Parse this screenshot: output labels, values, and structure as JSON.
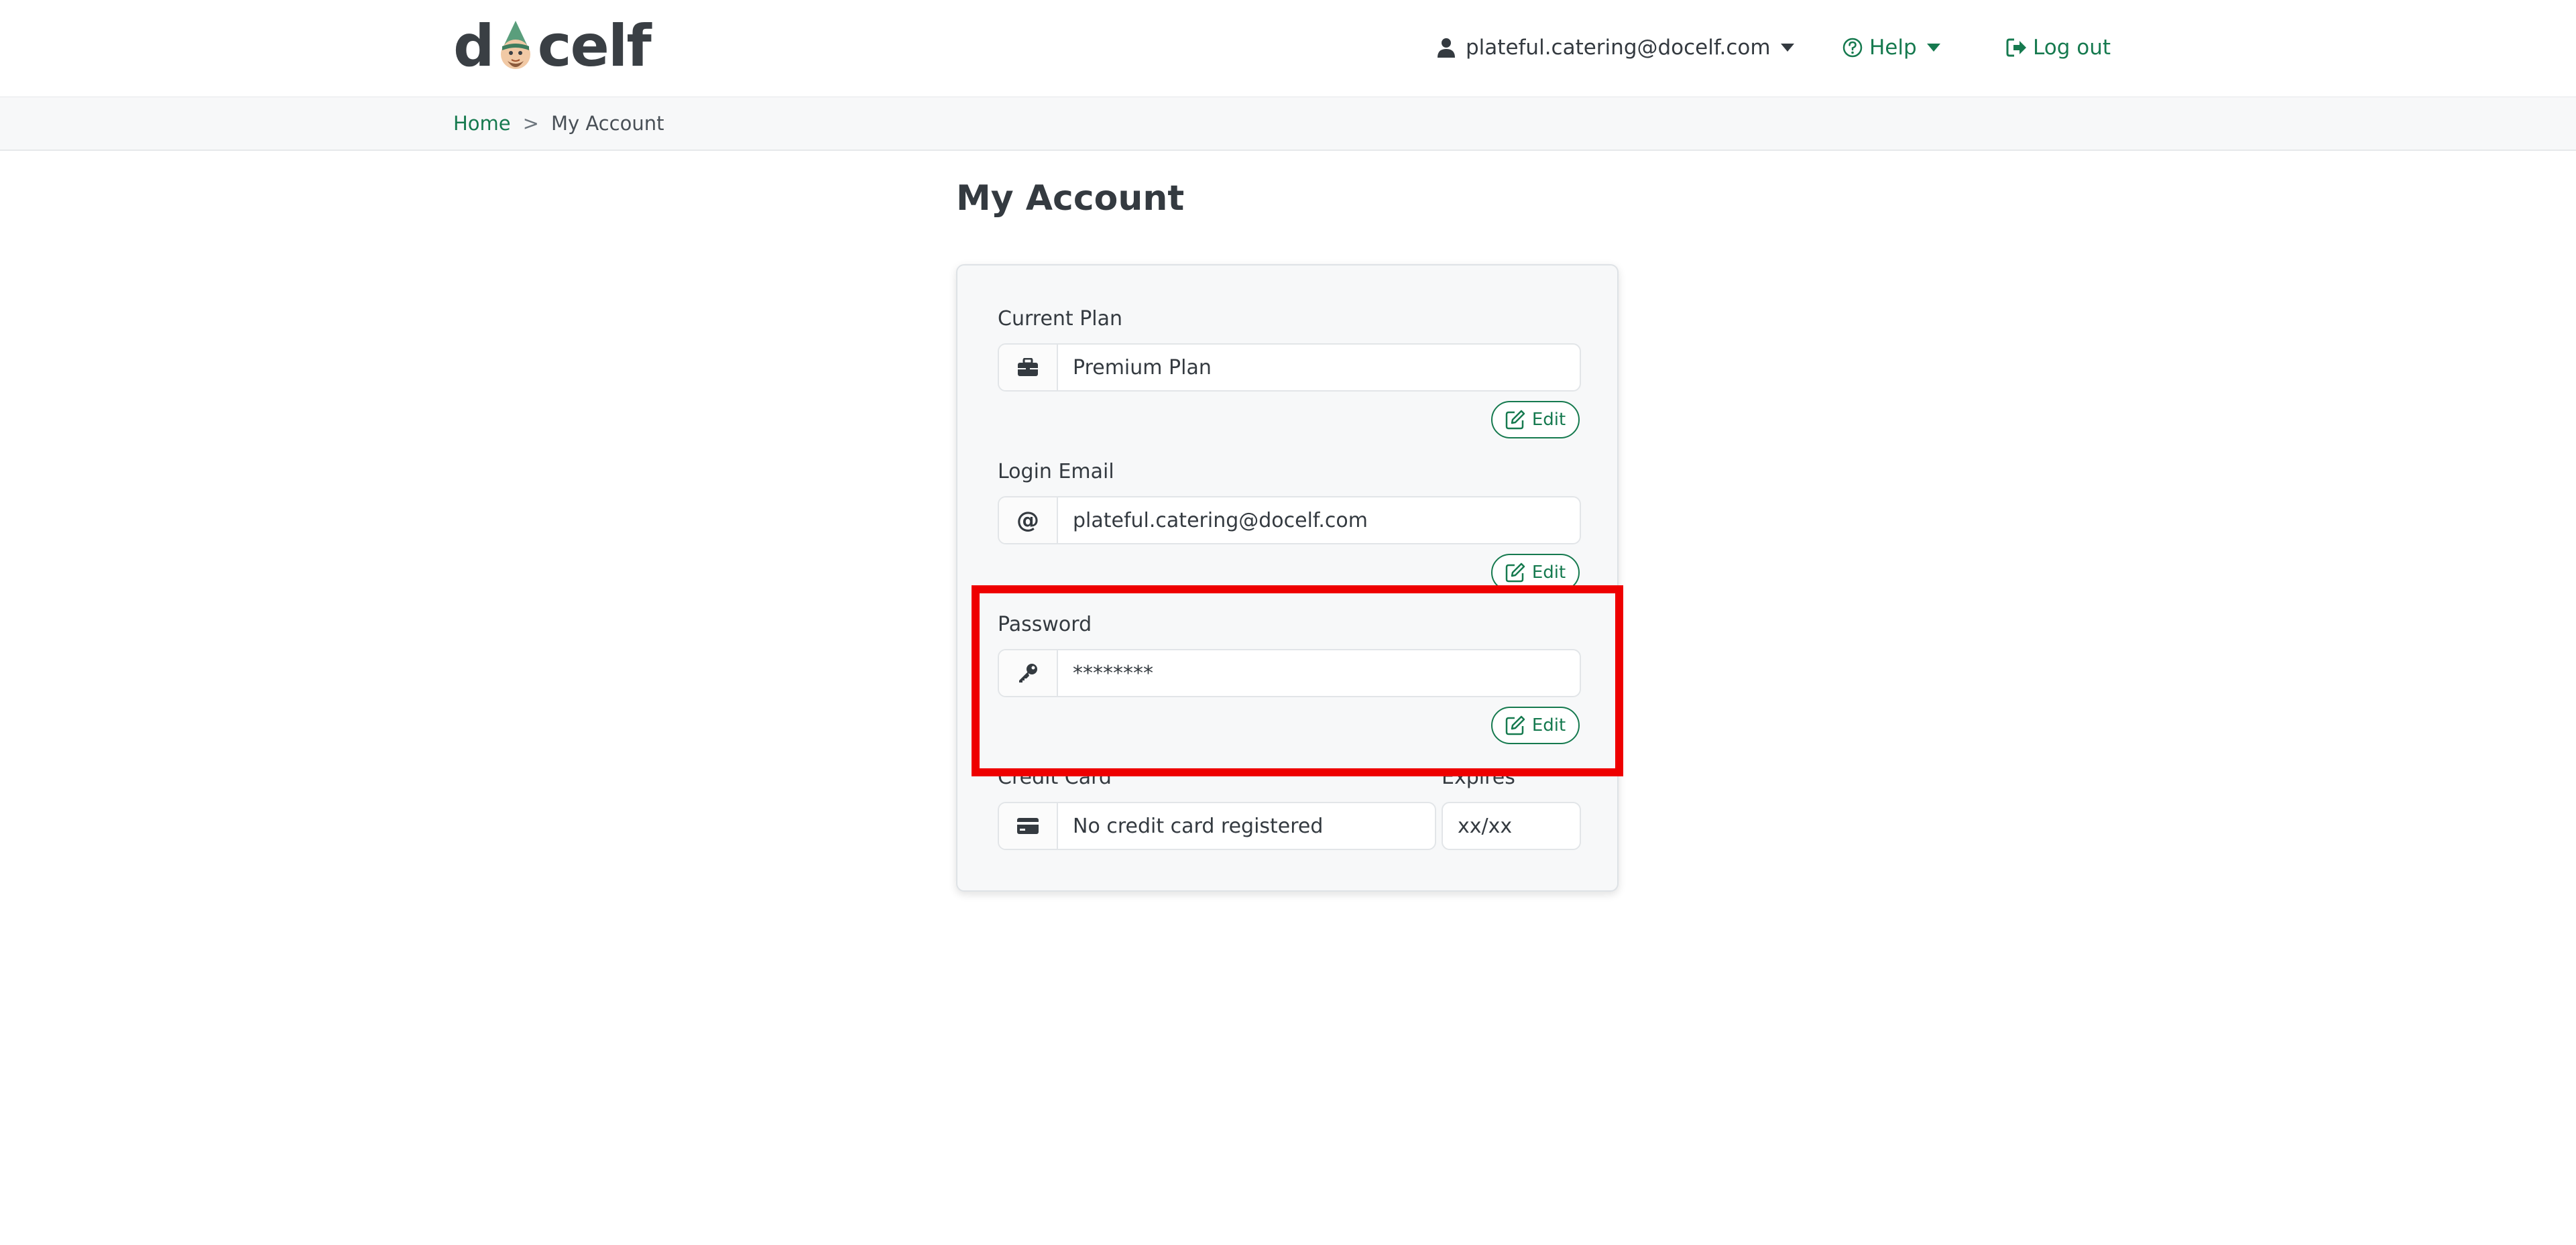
{
  "header": {
    "logo_left": "d",
    "logo_right": "celf",
    "user_email": "plateful.catering@docelf.com",
    "help_label": "Help",
    "logout_label": "Log out"
  },
  "breadcrumb": {
    "home": "Home",
    "separator": ">",
    "current": "My Account"
  },
  "page": {
    "title": "My Account"
  },
  "account": {
    "plan": {
      "label": "Current Plan",
      "value": "Premium Plan",
      "edit_label": "Edit",
      "icon": "briefcase-icon"
    },
    "email": {
      "label": "Login Email",
      "value": "plateful.catering@docelf.com",
      "edit_label": "Edit",
      "icon": "at-icon"
    },
    "password": {
      "label": "Password",
      "value": "********",
      "edit_label": "Edit",
      "icon": "key-icon"
    },
    "credit_card": {
      "label": "Credit Card",
      "value": "No credit card registered",
      "icon": "credit-card-icon"
    },
    "expires": {
      "label": "Expires",
      "value": "xx/xx"
    }
  },
  "colors": {
    "accent": "#167a4f",
    "highlight": "#ee0000"
  }
}
